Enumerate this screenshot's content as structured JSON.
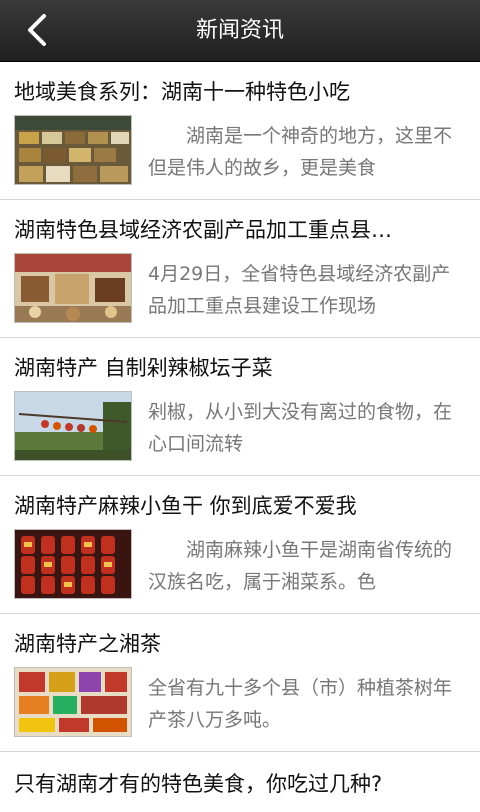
{
  "header": {
    "title": "新闻资讯",
    "back_icon": "chevron-left-icon"
  },
  "news": [
    {
      "title": "地域美食系列：湖南十一种特色小吃",
      "summary": "　　湖南是一个神奇的地方，这里不但是伟人的故乡，更是美食"
    },
    {
      "title": "湖南特色县域经济农副产品加工重点县…",
      "summary": "4月29日，全省特色县域经济农副产品加工重点县建设工作现场"
    },
    {
      "title": "湖南特产 自制剁辣椒坛子菜",
      "summary": "剁椒，从小到大没有离过的食物，在心口间流转"
    },
    {
      "title": "湖南特产麻辣小鱼干 你到底爱不爱我",
      "summary": "　　湖南麻辣小鱼干是湖南省传统的汉族名吃，属于湘菜系。色"
    },
    {
      "title": "湖南特产之湘茶",
      "summary": "全省有九十多个县（市）种植茶树年产茶八万多吨。"
    },
    {
      "title": "只有湖南才有的特色美食，你吃过几种?"
    }
  ],
  "colors": {
    "header_bg": "#2a2a2a",
    "title_text": "#111111",
    "summary_text": "#777777",
    "divider": "#d6d6d6"
  }
}
